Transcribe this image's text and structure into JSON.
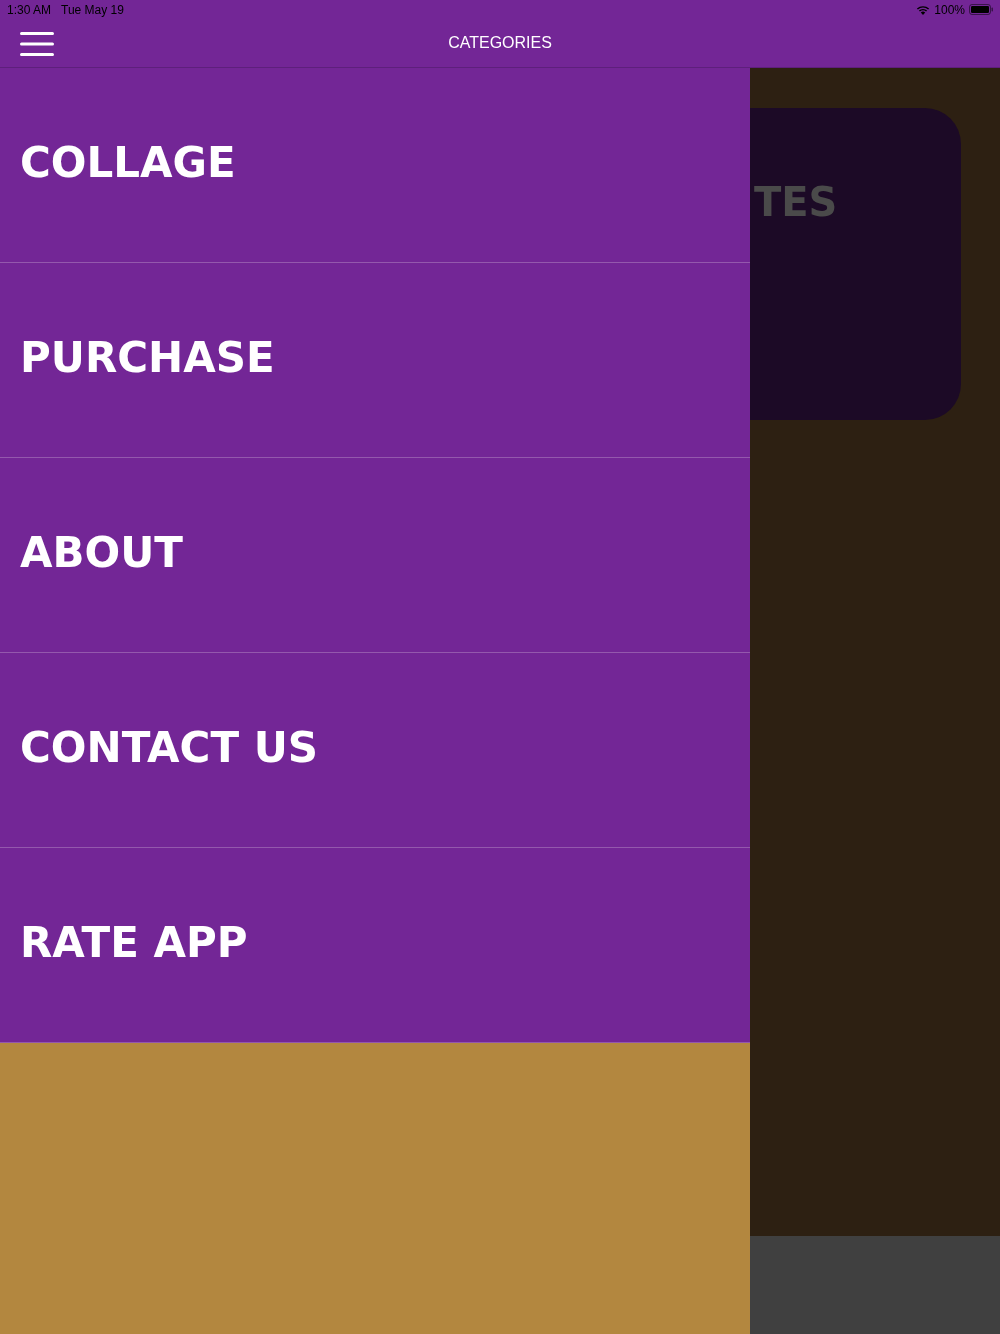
{
  "status_bar": {
    "time": "1:30 AM",
    "date": "Tue May 19",
    "battery_percent": "100%"
  },
  "nav_bar": {
    "title": "CATEGORIES"
  },
  "drawer": {
    "items": [
      {
        "label": "COLLAGE"
      },
      {
        "label": "PURCHASE"
      },
      {
        "label": "ABOUT"
      },
      {
        "label": "CONTACT US"
      },
      {
        "label": "RATE APP"
      }
    ]
  },
  "background_screen": {
    "card": {
      "title": "TES"
    }
  }
}
